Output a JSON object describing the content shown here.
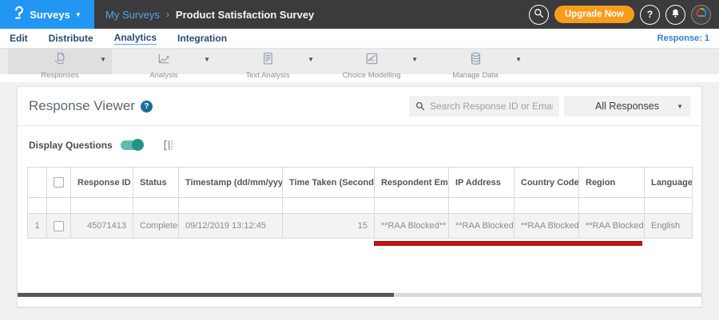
{
  "topbar": {
    "logo": "questionpro-logo",
    "product_label": "Surveys",
    "breadcrumb": {
      "parent": "My Surveys",
      "separator": "›",
      "current": "Product Satisfaction Survey"
    },
    "upgrade_label": "Upgrade Now",
    "help_glyph": "?"
  },
  "tabs": {
    "items": [
      "Edit",
      "Distribute",
      "Analytics",
      "Integration"
    ],
    "active_tab": "Analytics",
    "response_label": "Response: 1"
  },
  "toolbar": {
    "items": [
      {
        "label": "Responses",
        "icon": "responses-icon",
        "selected": true
      },
      {
        "label": "Analysis",
        "icon": "analysis-icon",
        "selected": false
      },
      {
        "label": "Text Analysis",
        "icon": "text-analysis-icon",
        "selected": false
      },
      {
        "label": "Choice Modelling",
        "icon": "choice-modelling-icon",
        "selected": false
      },
      {
        "label": "Manage Data",
        "icon": "manage-data-icon",
        "selected": false
      }
    ]
  },
  "viewer": {
    "title": "Response Viewer",
    "help_glyph": "?",
    "search_placeholder": "Search Response ID or Email",
    "responses_filter_value": "All Responses",
    "display_questions_label": "Display Questions",
    "display_questions_on": true
  },
  "table": {
    "columns": [
      {
        "label": "Response ID",
        "sort_icon": "▼"
      },
      {
        "label": "Status",
        "sort_icon": ""
      },
      {
        "label": "Timestamp (dd/mm/yyyy)",
        "sort_icon": "⇅"
      },
      {
        "label": "Time Taken (Seconds)",
        "sort_icon": "⇅"
      },
      {
        "label": "Respondent Email",
        "sort_icon": ""
      },
      {
        "label": "IP Address",
        "sort_icon": ""
      },
      {
        "label": "Country Code",
        "sort_icon": ""
      },
      {
        "label": "Region",
        "sort_icon": ""
      },
      {
        "label": "Language",
        "sort_icon": ""
      }
    ],
    "rows": [
      {
        "index": "1",
        "response_id": "45071413",
        "status": "Completed",
        "timestamp": "09/12/2019 13:12:45",
        "time_taken_seconds": "15",
        "respondent_email": "**RAA Blocked**",
        "ip_address": "**RAA Blocked**",
        "country_code": "**RAA Blocked**",
        "region": "**RAA Blocked**",
        "language": "English"
      }
    ]
  },
  "colors": {
    "topbar_blue": "#2196f3",
    "topbar_dark": "#3b3b3d",
    "upgrade_orange": "#f89c1c",
    "active_tab_underline": "#57a0dd",
    "toggle_teal": "#1f9586",
    "help_badge_blue": "#1a6e96",
    "annotation_red": "#c81414",
    "link_blue": "#4a7fb5"
  }
}
